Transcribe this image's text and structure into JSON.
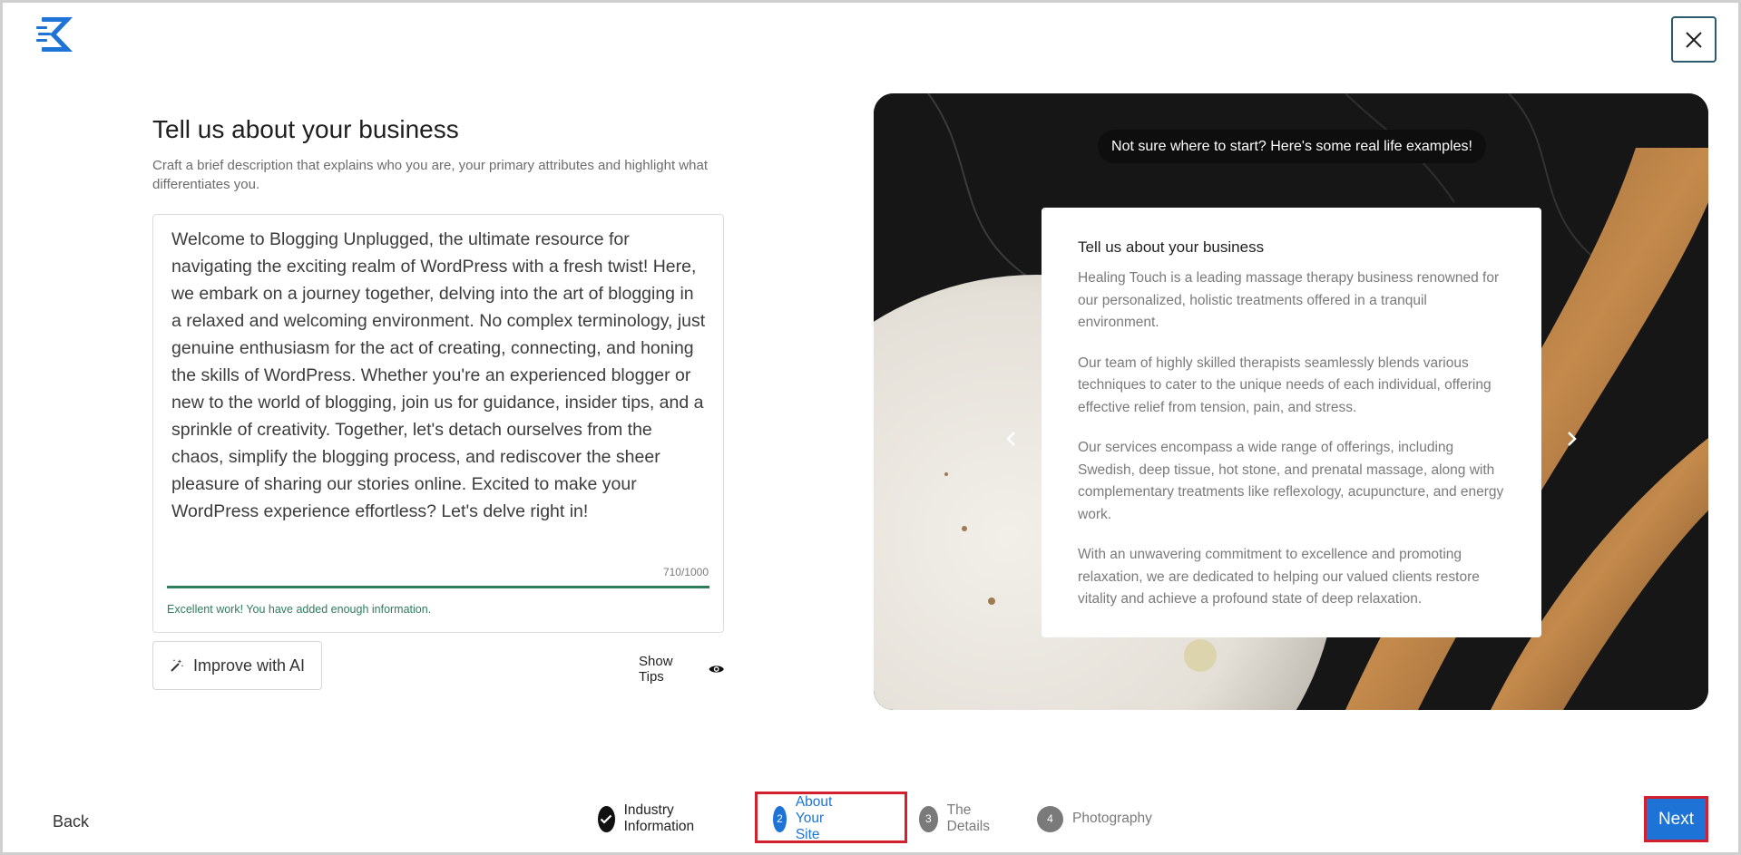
{
  "header": {
    "logo_icon": "kadence-logo-icon",
    "close_icon": "close-icon"
  },
  "form": {
    "title": "Tell us about your business",
    "subtitle": "Craft a brief description that explains who you are, your primary attributes and highlight what differentiates you.",
    "description_value": "Welcome to Blogging Unplugged, the ultimate resource for navigating the exciting realm of WordPress with a fresh twist! Here, we embark on a journey together, delving into the art of blogging in a relaxed and welcoming environment. No complex terminology, just genuine enthusiasm for the act of creating, connecting, and honing the skills of WordPress. Whether you're an experienced blogger or new to the world of blogging, join us for guidance, insider tips, and a sprinkle of creativity. Together, let's detach ourselves from the chaos, simplify the blogging process, and rediscover the sheer pleasure of sharing our stories online. Excited to make your WordPress experience effortless? Let's delve right in!",
    "char_count": "710/1000",
    "progress_fraction": 1.0,
    "feedback": "Excellent work! You have added enough information.",
    "improve_label": "Improve with AI",
    "tips_label": "Show Tips"
  },
  "examples": {
    "pill": "Not sure where to start? Here's some real life examples!",
    "card_title": "Tell us about your business",
    "paragraphs": [
      "Healing Touch is a leading massage therapy business renowned for our personalized, holistic treatments offered in a tranquil environment.",
      "Our team of highly skilled therapists seamlessly blends various techniques to cater to the unique needs of each individual, offering effective relief from tension, pain, and stress.",
      "Our services encompass a wide range of offerings, including Swedish, deep tissue, hot stone, and prenatal massage, along with complementary treatments like reflexology, acupuncture, and energy work.",
      "With an unwavering commitment to excellence and promoting relaxation, we are dedicated to helping our valued clients restore vitality and achieve a profound state of deep relaxation."
    ]
  },
  "footer": {
    "back_label": "Back",
    "next_label": "Next",
    "steps": [
      {
        "num": "",
        "label": "Industry Information",
        "state": "complete"
      },
      {
        "num": "2",
        "label": "About Your Site",
        "state": "active"
      },
      {
        "num": "3",
        "label": "The Details",
        "state": "upcoming"
      },
      {
        "num": "4",
        "label": "Photography",
        "state": "upcoming"
      }
    ]
  },
  "colors": {
    "accent": "#1e73d6",
    "success": "#2e7d5b",
    "highlight": "#d3202f",
    "step_gray": "#7a7a7a"
  }
}
